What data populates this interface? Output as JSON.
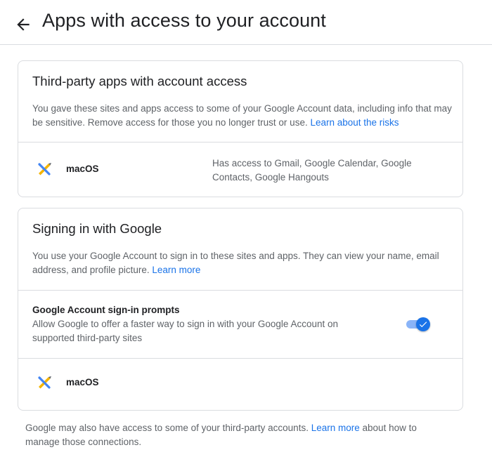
{
  "header": {
    "title": "Apps with access to your account",
    "back_icon": "arrow-back-icon"
  },
  "third_party": {
    "title": "Third-party apps with account access",
    "description": "You gave these sites and apps access to some of your Google Account data, including info that may be sensitive. Remove access for those you no longer trust or use.",
    "link": "Learn about the risks",
    "apps": [
      {
        "name": "macOS",
        "icon": "macos-app-icon",
        "access": "Has access to Gmail, Google Calendar, Google Contacts, Google Hangouts"
      }
    ]
  },
  "signing_in": {
    "title": "Signing in with Google",
    "description": "You use your Google Account to sign in to these sites and apps. They can view your name, email address, and profile picture.",
    "link": "Learn more",
    "setting": {
      "title": "Google Account sign-in prompts",
      "description": "Allow Google to offer a faster way to sign in with your Google Account on supported third-party sites",
      "enabled": true
    },
    "apps": [
      {
        "name": "macOS",
        "icon": "macos-app-icon"
      }
    ]
  },
  "footer": {
    "before": "Google may also have access to some of your third-party accounts.",
    "link": "Learn more",
    "after": "about how to manage those connections."
  },
  "colors": {
    "link": "#1a73e8",
    "toggle_on": "#1a73e8",
    "border": "#dadce0"
  }
}
